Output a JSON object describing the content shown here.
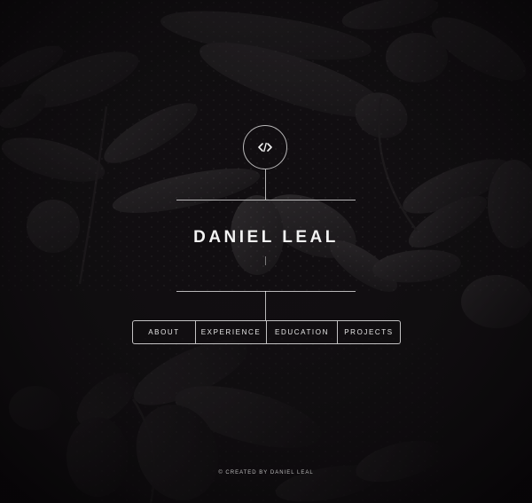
{
  "background": {
    "image": "dark-leaves-with-raindrops-photo",
    "tint": "#0d0c0d"
  },
  "logo": {
    "icon": "code-brackets-icon",
    "glyph": "</>"
  },
  "hero": {
    "name": "DANIEL LEAL"
  },
  "nav": {
    "items": [
      {
        "label": "ABOUT"
      },
      {
        "label": "EXPERIENCE"
      },
      {
        "label": "EDUCATION"
      },
      {
        "label": "PROJECTS"
      }
    ]
  },
  "footer": {
    "text": "© CREATED BY DANIEL LEAL"
  },
  "colors": {
    "text": "#f2f2f2",
    "lines": "#ffffff",
    "background": "#0d0c0d"
  }
}
